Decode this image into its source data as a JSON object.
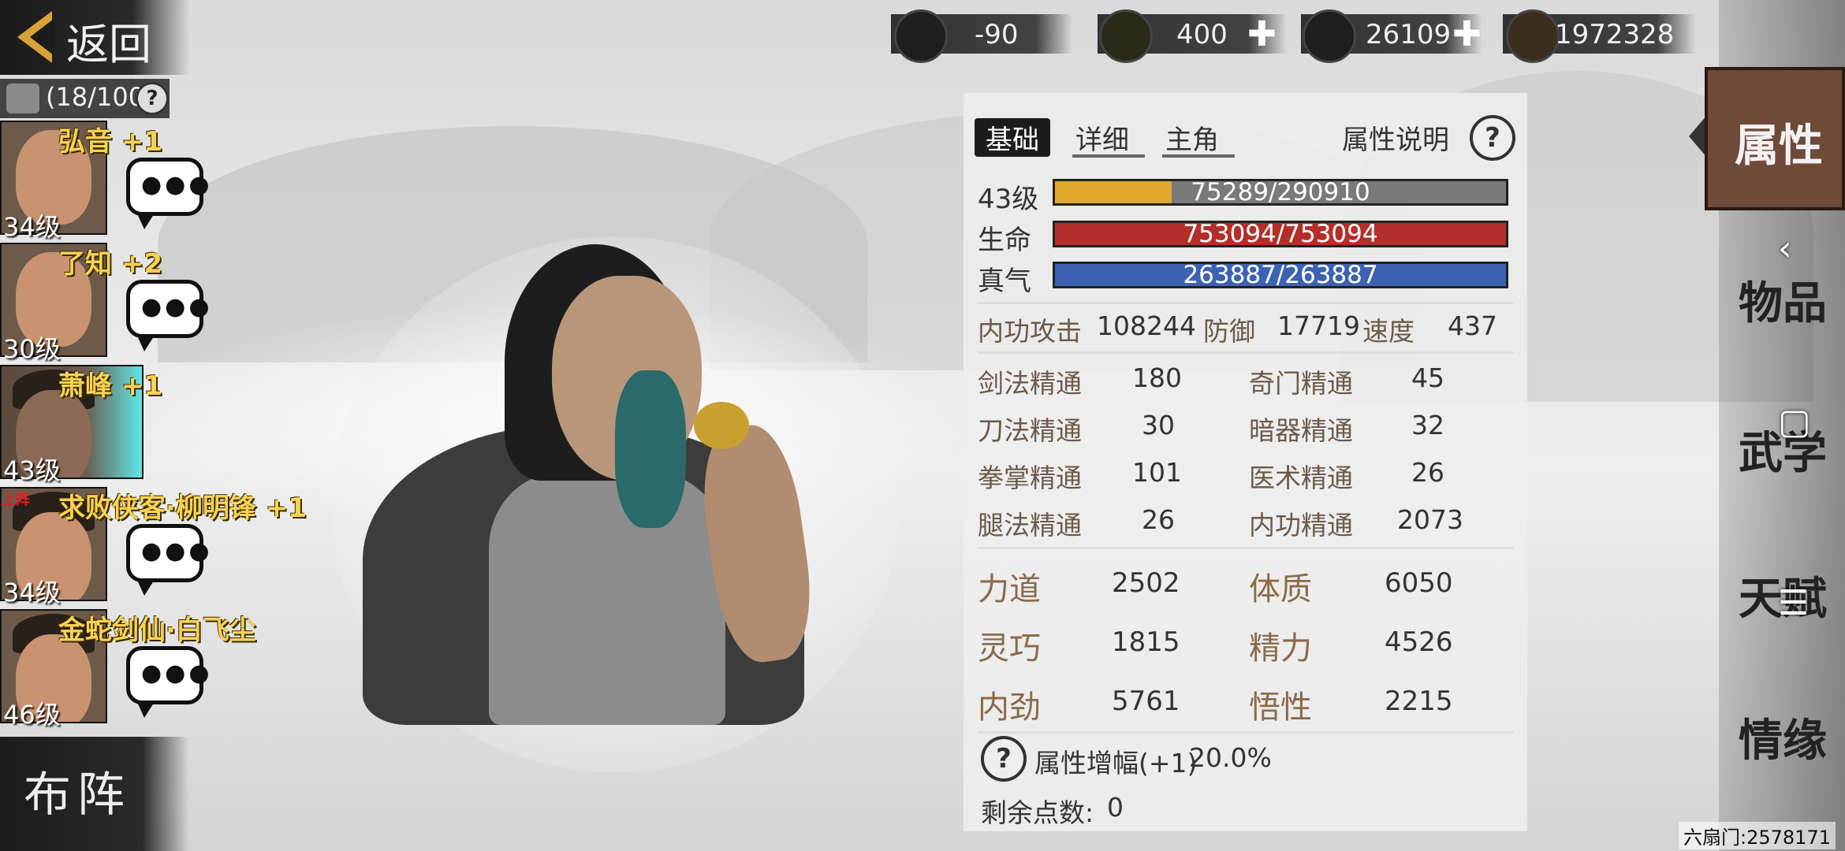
{
  "nav": {
    "back_label": "返回",
    "roster_count": "(18/100",
    "help": "?"
  },
  "roster": [
    {
      "name": "弘音",
      "bonus": "+1",
      "level": "34级",
      "onfield": ""
    },
    {
      "name": "了知",
      "bonus": "+2",
      "level": "30级",
      "onfield": ""
    },
    {
      "name": "萧峰",
      "bonus": "+1",
      "level": "43级",
      "onfield": ""
    },
    {
      "name": "求败侠客·柳明锋",
      "bonus": "+1",
      "level": "34级",
      "onfield": "上阵"
    },
    {
      "name": "金蛇剑仙·白飞尘",
      "bonus": "",
      "level": "46级",
      "onfield": ""
    }
  ],
  "formation_label": "布阵",
  "currency": [
    {
      "icon": "cauldron-icon",
      "value": "-90",
      "plus": false
    },
    {
      "icon": "gold-bar-icon",
      "value": "400",
      "plus": true
    },
    {
      "icon": "silver-ingot-icon",
      "value": "26109",
      "plus": true
    },
    {
      "icon": "copper-coin-icon",
      "value": "1972328",
      "plus": false
    }
  ],
  "tabs": [
    "基础",
    "详细",
    "主角"
  ],
  "attr_help_label": "属性说明",
  "bars": [
    {
      "label": "43级",
      "text": "75289/290910",
      "fraction": 0.259,
      "color": "#e0a92e"
    },
    {
      "label": "生命",
      "text": "753094/753094",
      "fraction": 1.0,
      "color": "#b3302a"
    },
    {
      "label": "真气",
      "text": "263887/263887",
      "fraction": 1.0,
      "color": "#3d62b3"
    }
  ],
  "combat": {
    "attack_label": "内功攻击",
    "attack_value": "108244",
    "defense_label": "防御",
    "defense_value": "17719",
    "speed_label": "速度",
    "speed_value": "437"
  },
  "mastery": [
    {
      "label": "剑法精通",
      "value": "180"
    },
    {
      "label": "奇门精通",
      "value": "45"
    },
    {
      "label": "刀法精通",
      "value": "30"
    },
    {
      "label": "暗器精通",
      "value": "32"
    },
    {
      "label": "拳掌精通",
      "value": "101"
    },
    {
      "label": "医术精通",
      "value": "26"
    },
    {
      "label": "腿法精通",
      "value": "26"
    },
    {
      "label": "内功精通",
      "value": "2073"
    }
  ],
  "attributes": [
    {
      "label": "力道",
      "value": "2502"
    },
    {
      "label": "体质",
      "value": "6050"
    },
    {
      "label": "灵巧",
      "value": "1815"
    },
    {
      "label": "精力",
      "value": "4526"
    },
    {
      "label": "内劲",
      "value": "5761"
    },
    {
      "label": "悟性",
      "value": "2215"
    }
  ],
  "bonus_label": "属性增幅(+1)",
  "bonus_value": "20.0%",
  "remaining_label": "剩余点数:",
  "remaining_value": "0",
  "right_menu": [
    "属性",
    "物品",
    "武学",
    "天赋",
    "情缘"
  ],
  "server_id": "六扇门:2578171",
  "overlay_icons": [
    "back-nav-icon",
    "home-nav-icon",
    "menu-nav-icon"
  ]
}
